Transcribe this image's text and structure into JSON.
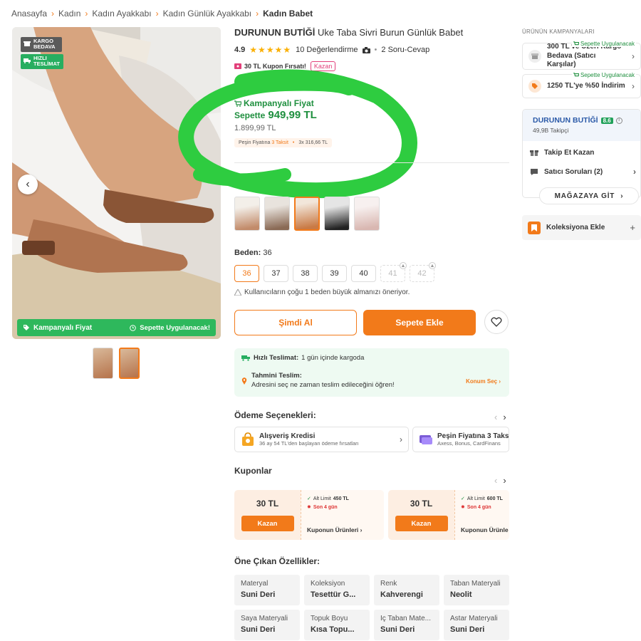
{
  "breadcrumb": [
    "Anasayfa",
    "Kadın",
    "Kadın Ayakkabı",
    "Kadın Günlük Ayakkabı",
    "Kadın Babet"
  ],
  "gallery": {
    "cargo_badge": "KARGO BEDAVA",
    "fast_badge": "HIZLI TESLİMAT",
    "bottom_left": "Kampanyalı Fiyat",
    "bottom_right": "Sepette Uygulanacak!"
  },
  "product": {
    "brand": "DURUNUN BUTİĞİ",
    "name": "Uke Taba Sivri Burun Günlük Babet",
    "rating": "4.9",
    "rating_stars": 5,
    "reviews": "10 Değerlendirme",
    "qa": "2 Soru-Cevap",
    "coupon_text": "30 TL Kupon Fırsatı!",
    "coupon_action": "Kazan"
  },
  "price": {
    "campaign_label": "Kampanyalı Fiyat",
    "basket_word": "Sepette",
    "basket_price": "949,99 TL",
    "old_price": "1.899,99 TL",
    "installment_a": "Peşin Fiyatına",
    "installment_b": "3 Taksit",
    "installment_c": "3x",
    "installment_d": "316,66 TL"
  },
  "size": {
    "label": "Beden:",
    "selected": "36",
    "options": [
      "36",
      "37",
      "38",
      "39",
      "40",
      "41",
      "42"
    ],
    "note": "Kullanıcıların çoğu 1 beden büyük almanızı öneriyor."
  },
  "actions": {
    "buy_now": "Şimdi Al",
    "add_to_cart": "Sepete Ekle"
  },
  "delivery": {
    "fast_title": "Hızlı Teslimat:",
    "fast_text": "1 gün içinde kargoda",
    "est_title": "Tahmini Teslim:",
    "est_text": "Adresini seç ne zaman teslim edileceğini öğren!",
    "location_link": "Konum Seç"
  },
  "payment": {
    "title": "Ödeme Seçenekleri:",
    "cards": [
      {
        "title": "Alışveriş Kredisi",
        "subtitle": "36 ay 54 TL'den başlayan ödeme fırsatları"
      },
      {
        "title": "Peşin Fiyatına 3 Taks",
        "subtitle": "Axess, Bonus, CardFinans"
      }
    ]
  },
  "coupons": {
    "title": "Kuponlar",
    "items": [
      {
        "amount": "30 TL",
        "button": "Kazan",
        "limit_label": "Alt Limit",
        "limit_value": "450 TL",
        "days": "Son 4 gün",
        "products": "Kuponun Ürünleri"
      },
      {
        "amount": "30 TL",
        "button": "Kazan",
        "limit_label": "Alt Limit",
        "limit_value": "600 TL",
        "days": "Son 4 gün",
        "products": "Kuponun Ürünle"
      }
    ]
  },
  "features": {
    "title": "Öne Çıkan Özellikler:",
    "items": [
      {
        "key": "Materyal",
        "value": "Suni Deri"
      },
      {
        "key": "Koleksiyon",
        "value": "Tesettür G..."
      },
      {
        "key": "Renk",
        "value": "Kahverengi"
      },
      {
        "key": "Taban Materyali",
        "value": "Neolit"
      },
      {
        "key": "Saya Materyali",
        "value": "Suni Deri"
      },
      {
        "key": "Topuk Boyu",
        "value": "Kısa Topu..."
      },
      {
        "key": "İç Taban Mate...",
        "value": "Suni Deri"
      },
      {
        "key": "Astar Materyali",
        "value": "Suni Deri"
      }
    ]
  },
  "sidebar": {
    "campaigns_title": "ÜRÜNÜN KAMPANYALARI",
    "campaigns": [
      {
        "tag": "Sepette Uygulanacak",
        "text": "300 TL ve Üzeri Kargo Bedava (Satıcı Karşılar)"
      },
      {
        "tag": "Sepette Uygulanacak",
        "text": "1250 TL'ye %50 İndirim"
      }
    ],
    "seller": {
      "name": "DURUNUN BUTİĞİ",
      "score": "8.6",
      "followers": "49,9B Takipçi",
      "follow": "Takip Et Kazan",
      "questions": "Satıcı Soruları (2)",
      "store_button": "MAĞAZAYA GİT"
    },
    "collection": "Koleksiyona Ekle"
  },
  "colors": {
    "accent": "#f27a1a",
    "green": "#1e8f3e",
    "highlight_ring": "#2ecc40"
  }
}
